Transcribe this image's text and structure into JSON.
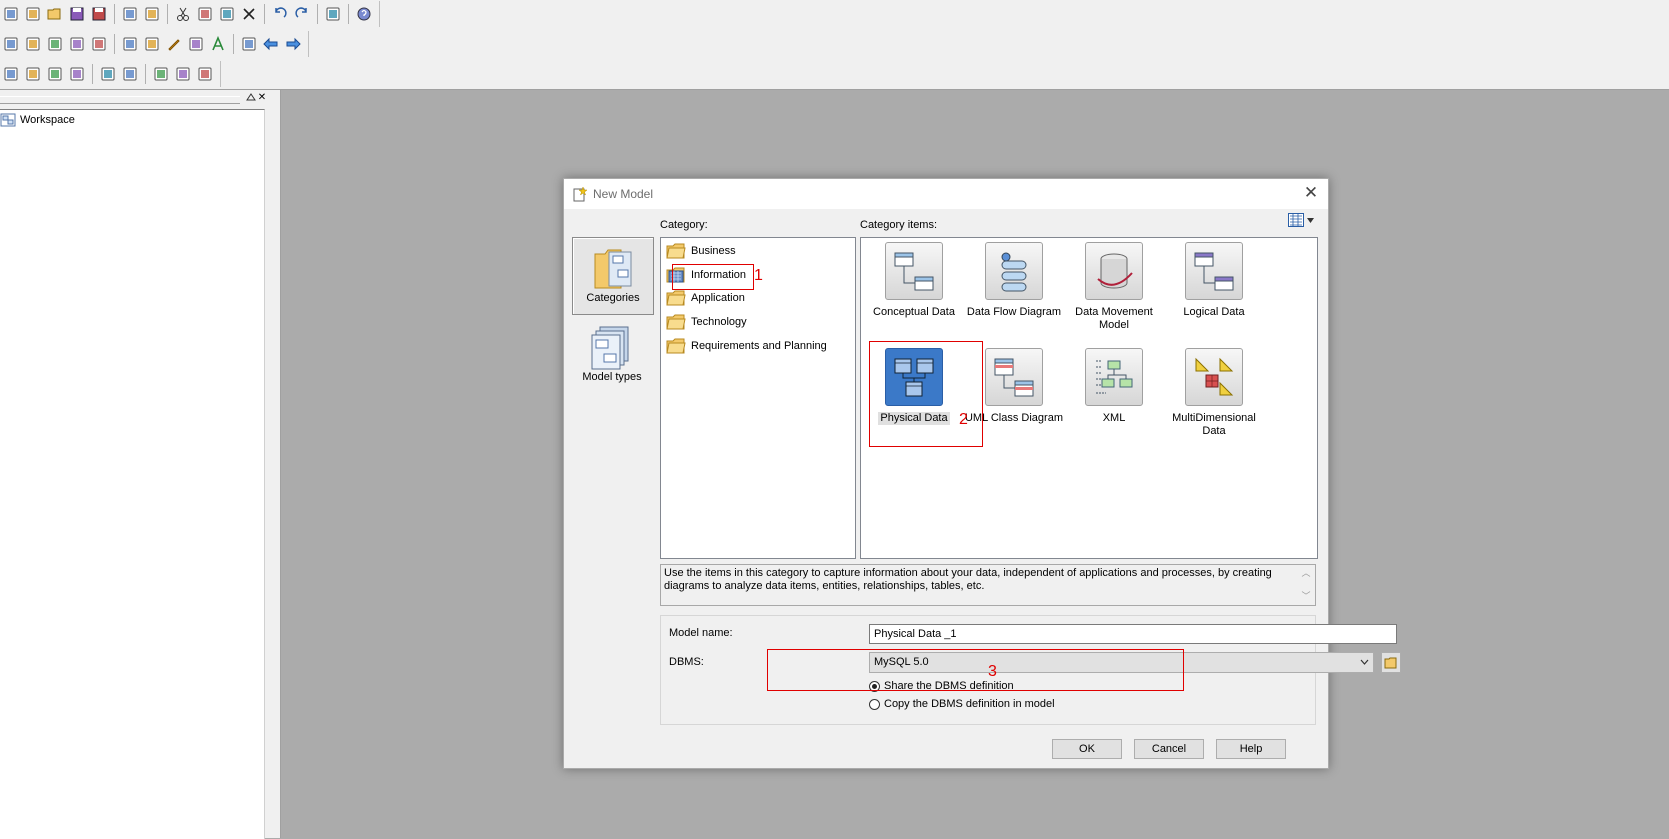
{
  "toolbar": {
    "row1": [
      "new-icon",
      "open-package-icon",
      "open-icon",
      "save-icon",
      "save-all-icon",
      "|",
      "print-preview-icon",
      "print-icon",
      "|",
      "cut-icon",
      "copy-icon",
      "paste-icon",
      "delete-icon",
      "|",
      "undo-icon",
      "redo-icon",
      "|",
      "properties-icon",
      "|",
      "help-icon"
    ],
    "row2": [
      "model-icon",
      "package-icon",
      "find-icon",
      "refresh-icon",
      "check-model-icon",
      "|",
      "shadow-icon",
      "grid-icon",
      "pen-icon",
      "fill-icon",
      "font-icon",
      "|",
      "import-icon",
      "back-icon",
      "forward-icon"
    ],
    "row3": [
      "diagram-icon",
      "diagram2-icon",
      "page-icon",
      "page2-icon",
      "|",
      "symbol-icon",
      "symbol2-icon",
      "|",
      "zoom-icon",
      "display-icon",
      "layout-icon"
    ]
  },
  "workspace": {
    "root_label": "Workspace",
    "close_symbol": "✕"
  },
  "dialog": {
    "title": "New Model",
    "close_symbol": "✕",
    "side_buttons": [
      {
        "label": "Categories",
        "selected": true
      },
      {
        "label": "Model types",
        "selected": false
      }
    ],
    "category_label": "Category:",
    "categories": [
      "Business",
      "Information",
      "Application",
      "Technology",
      "Requirements and Planning"
    ],
    "items_label": "Category items:",
    "items": [
      {
        "label": "Conceptual Data",
        "icon": "conceptual-data-icon"
      },
      {
        "label": "Data Flow Diagram",
        "icon": "data-flow-icon"
      },
      {
        "label": "Data Movement Model",
        "icon": "data-movement-icon"
      },
      {
        "label": "Logical Data",
        "icon": "logical-data-icon"
      },
      {
        "label": "Physical Data",
        "icon": "physical-data-icon",
        "selected": true
      },
      {
        "label": "UML Class Diagram",
        "icon": "uml-class-icon"
      },
      {
        "label": "XML",
        "icon": "xml-icon"
      },
      {
        "label": "MultiDimensional Data",
        "icon": "multidimensional-icon"
      }
    ],
    "description": "Use the items in this category to capture information about your data, independent of applications and processes, by creating diagrams to analyze data items, entities, relationships, tables, etc.",
    "model_name_label": "Model name:",
    "model_name_value": "Physical Data _1",
    "dbms_label": "DBMS:",
    "dbms_value": "MySQL 5.0",
    "share_option": "Share the DBMS definition",
    "copy_option": "Copy the DBMS definition in model",
    "ok_label": "OK",
    "cancel_label": "Cancel",
    "help_label": "Help"
  },
  "annotations": [
    "1",
    "2",
    "3"
  ],
  "colors": {
    "annotation": "#e00000",
    "selection": "#3b79c8",
    "background": "#ababab"
  }
}
